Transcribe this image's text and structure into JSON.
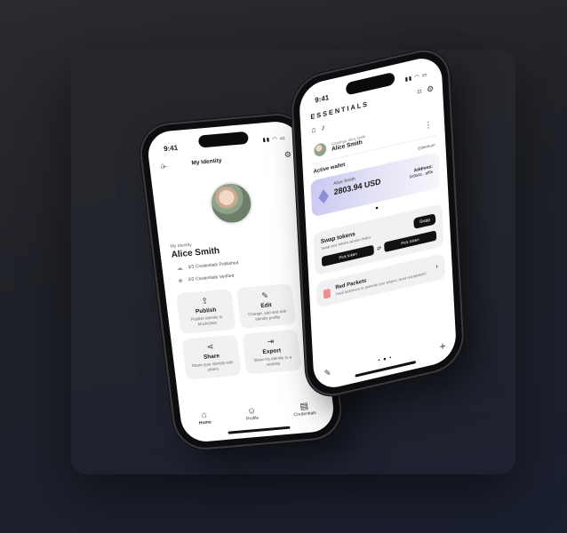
{
  "phone1": {
    "status_time": "9:41",
    "nav_title": "My Identity",
    "identity_label": "My Identity",
    "identity_name": "Alice Smith",
    "credentials": [
      "3/3 Credentials Published",
      "2/2 Credentials Verified"
    ],
    "tiles": [
      {
        "title": "Publish",
        "desc": "Publish identity to blockchain",
        "icon": "upload-icon"
      },
      {
        "title": "Edit",
        "desc": "Change, add and edit identity profile",
        "icon": "pencil-icon"
      },
      {
        "title": "Share",
        "desc": "Share your identity with others",
        "icon": "share-icon"
      },
      {
        "title": "Export",
        "desc": "Show my identity to a website",
        "icon": "export-icon"
      }
    ],
    "tabs": [
      {
        "label": "Home",
        "icon": "home-icon",
        "active": true
      },
      {
        "label": "Profile",
        "icon": "person-icon",
        "active": false
      },
      {
        "label": "Credentials",
        "icon": "credentials-icon",
        "active": false
      }
    ]
  },
  "phone2": {
    "status_time": "9:41",
    "brand": "ESSENTIALS",
    "account_sub": "Greetings, Alice Smith",
    "account_name": "Alice Smith",
    "active_wallet_label": "Active wallet",
    "network": "Ethereum",
    "wallet_name": "Alice Smith",
    "wallet_balance": "2803.94 USD",
    "address_label": "Address:",
    "address_value": "0x9a4c...af8e",
    "swap_title": "Swap tokens",
    "swap_sub": "Swap your tokens across chains",
    "swap_button": "Swap",
    "pick_from": "Pick token",
    "pick_to": "Pick token",
    "red_title": "Red Packets",
    "red_sub": "Have luck/more or promote your project, send red packets!"
  },
  "colors": {
    "bg": "#1f2128",
    "phone_frame": "#0d0d0f",
    "wallet_card": "#c9c8f1",
    "accent_dark": "#111111"
  }
}
